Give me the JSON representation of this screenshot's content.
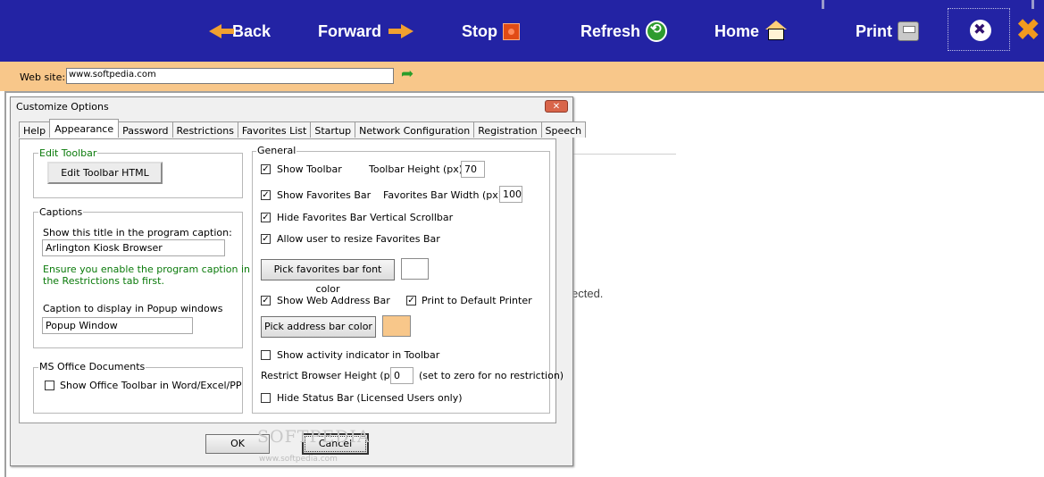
{
  "toolbar": {
    "back": "Back",
    "forward": "Forward",
    "stop": "Stop",
    "refresh": "Refresh",
    "home": "Home",
    "print": "Print",
    "settings_icon": "settings-tools-icon",
    "close_icon": "close-x-icon",
    "colors": {
      "background": "#2323a4",
      "arrow": "#f0a030",
      "close": "#f29a1e"
    }
  },
  "address_bar": {
    "label": "Web site:",
    "value": "www.softpedia.com",
    "background": "#f8c78a"
  },
  "page": {
    "visible_text": "ected."
  },
  "dialog": {
    "title": "Customize Options",
    "tabs": [
      {
        "label": "Help",
        "active": false
      },
      {
        "label": "Appearance",
        "active": true
      },
      {
        "label": "Password",
        "active": false
      },
      {
        "label": "Restrictions",
        "active": false
      },
      {
        "label": "Favorites List",
        "active": false
      },
      {
        "label": "Startup",
        "active": false
      },
      {
        "label": "Network Configuration",
        "active": false
      },
      {
        "label": "Registration",
        "active": false
      },
      {
        "label": "Speech",
        "active": false
      }
    ],
    "edit_toolbar": {
      "title": "Edit Toolbar",
      "button": "Edit Toolbar HTML"
    },
    "captions": {
      "title": "Captions",
      "caption_label": "Show this title in the program caption:",
      "caption_value": "Arlington Kiosk Browser",
      "note_line1": "Ensure you enable the program caption in",
      "note_line2": "the Restrictions tab first.",
      "popup_label": "Caption to display in Popup windows",
      "popup_value": "Popup Window"
    },
    "ms_office": {
      "title": "MS Office Documents",
      "checkbox_label": "Show Office Toolbar in Word/Excel/PP",
      "checked": false
    },
    "general": {
      "title": "General",
      "show_toolbar": {
        "label": "Show Toolbar",
        "checked": true
      },
      "toolbar_height_label": "Toolbar Height (px)",
      "toolbar_height_value": "70",
      "show_favorites": {
        "label": "Show Favorites Bar",
        "checked": true
      },
      "favorites_width_label": "Favorites Bar Width (px)",
      "favorites_width_value": "100",
      "hide_fav_scroll": {
        "label": "Hide Favorites Bar Vertical Scrollbar",
        "checked": true
      },
      "allow_resize": {
        "label": "Allow user to resize Favorites Bar",
        "checked": true
      },
      "pick_font_color_button": "Pick favorites bar font color",
      "font_color": "#ffffff",
      "show_address_bar": {
        "label": "Show Web Address Bar",
        "checked": true
      },
      "print_default": {
        "label": "Print to Default Printer",
        "checked": true
      },
      "pick_address_color_button": "Pick address bar color",
      "address_color": "#f8c78a",
      "activity_indicator": {
        "label": "Show activity indicator in Toolbar",
        "checked": false
      },
      "restrict_height_label": "Restrict Browser Height (px)",
      "restrict_height_value": "0",
      "restrict_height_note": "(set to zero for no restriction)",
      "hide_status": {
        "label": "Hide Status Bar (Licensed Users only)",
        "checked": false
      }
    },
    "ok_button": "OK",
    "cancel_button": "Cancel"
  },
  "watermark": {
    "text": "SOFTPEDIA",
    "url": "www.softpedia.com"
  }
}
